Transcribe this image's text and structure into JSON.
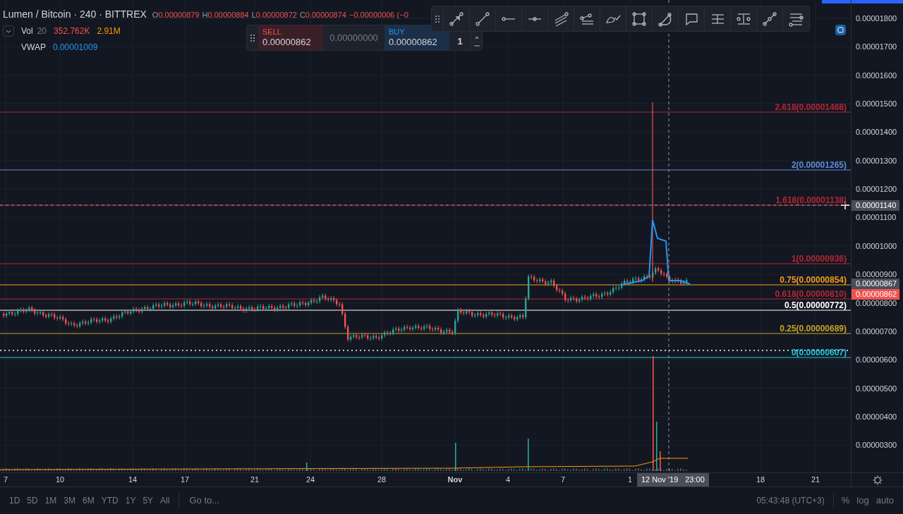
{
  "legend": {
    "title": "Lumen / Bitcoin · 240 · BITTREX",
    "ohlc": [
      {
        "label": "O",
        "value": "0.00000879"
      },
      {
        "label": "H",
        "value": "0.00000884"
      },
      {
        "label": "L",
        "value": "0.00000872"
      },
      {
        "label": "C",
        "value": "0.00000874"
      }
    ],
    "change": "−0.00000006 (−0",
    "indicators": [
      {
        "name": "Vol",
        "param": "20",
        "values": [
          {
            "text": "352.762K",
            "color": "#ef5350"
          },
          {
            "text": "2.91M",
            "color": "#ff9800"
          }
        ]
      },
      {
        "name": "VWAP",
        "values": [
          {
            "text": "0.00001009",
            "color": "#2196f3"
          }
        ]
      }
    ]
  },
  "trade_panel": {
    "sell_label": "SELL",
    "sell_price": "0.00000862",
    "spread": "0.00000000",
    "buy_label": "BUY",
    "buy_price": "0.00000862",
    "quantity": "1"
  },
  "fib_levels": [
    {
      "label": "2.618(0.00001468)",
      "color": "#b22833"
    },
    {
      "label": "2(0.00001265)",
      "color": "#5b8fd6"
    },
    {
      "label": "1.618(0.00001138)",
      "color": "#b22833"
    },
    {
      "label": "1(0.00000936)",
      "color": "#b22833"
    },
    {
      "label": "0.75(0.00000854)",
      "color": "#f59d1a"
    },
    {
      "label": "0.618(0.00000810)",
      "color": "#b22833"
    },
    {
      "label": "0.5(0.00000772)",
      "color": "#ffffff"
    },
    {
      "label": "0.25(0.00000689)",
      "color": "#c9a227"
    },
    {
      "label": "0(0.00000607)",
      "color": "#22c5d8"
    }
  ],
  "price_axis": {
    "labels": [
      "0.00001800",
      "0.00001700",
      "0.00001600",
      "0.00001500",
      "0.00001400",
      "0.00001300",
      "0.00001200",
      "0.00001100",
      "0.00001000",
      "0.00000900",
      "0.00000800",
      "0.00000700",
      "0.00000600",
      "0.00000500",
      "0.00000400",
      "0.00000300"
    ],
    "tags": [
      {
        "kind": "crosshair",
        "value": "0.00001140"
      },
      {
        "kind": "last",
        "value": "0.00000867"
      },
      {
        "kind": "bid",
        "value": "0.00000862"
      }
    ]
  },
  "time_axis": {
    "labels": [
      {
        "text": "7",
        "month": false
      },
      {
        "text": "10",
        "month": false
      },
      {
        "text": "14",
        "month": false
      },
      {
        "text": "17",
        "month": false
      },
      {
        "text": "21",
        "month": false
      },
      {
        "text": "24",
        "month": false
      },
      {
        "text": "28",
        "month": false
      },
      {
        "text": "Nov",
        "month": true
      },
      {
        "text": "4",
        "month": false
      },
      {
        "text": "7",
        "month": false
      },
      {
        "text": "1",
        "month": false
      },
      {
        "text": "18",
        "month": false
      },
      {
        "text": "21",
        "month": false
      }
    ],
    "crosshair_date": "12 Nov '19",
    "crosshair_time": "23:00"
  },
  "bottom_bar": {
    "ranges": [
      "1D",
      "5D",
      "1M",
      "3M",
      "6M",
      "YTD",
      "1Y",
      "5Y",
      "All"
    ],
    "goto": "Go to...",
    "clock": "05:43:48 (UTC+3)",
    "options": [
      "%",
      "log",
      "auto"
    ]
  }
}
